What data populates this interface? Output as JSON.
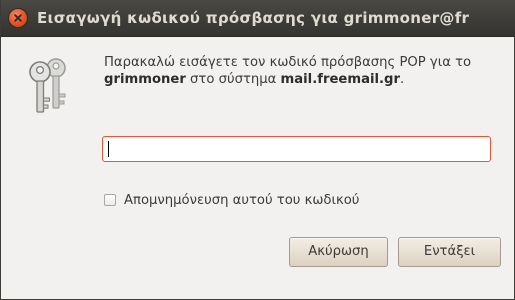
{
  "window": {
    "title": "Εισαγωγή κωδικού πρόσβασης για grimmoner@fr"
  },
  "message": {
    "prefix": "Παρακαλώ εισάγετε τον κωδικό πρόσβασης POP για το ",
    "username": "grimmoner",
    "middle": " στο σύστημα ",
    "server": "mail.freemail.gr",
    "suffix": "."
  },
  "password_field": {
    "value": "",
    "placeholder": ""
  },
  "remember": {
    "label": "Απομνημόνευση αυτού του κωδικού",
    "checked": false
  },
  "buttons": {
    "cancel_label": "Ακύρωση",
    "ok_label": "Εντάξει"
  },
  "colors": {
    "titlebar": "#3c3b37",
    "close_button": "#e2531f",
    "input_focus_border": "#e05a35",
    "window_bg": "#f2f1f0"
  },
  "icons": {
    "window_close": "close-icon",
    "dialog": "keys-icon"
  }
}
